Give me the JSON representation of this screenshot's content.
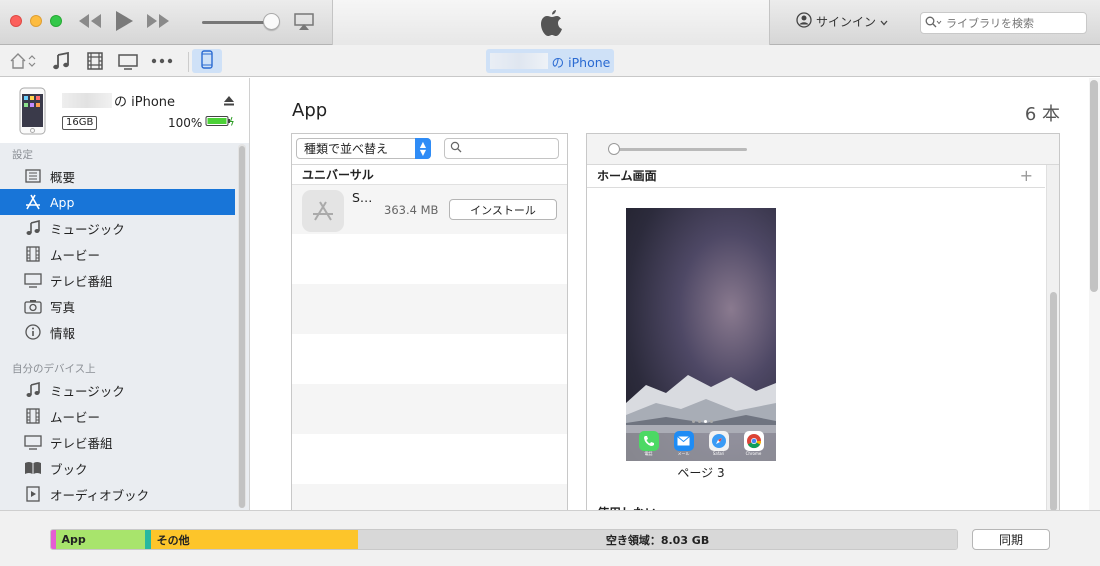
{
  "titlebar": {
    "signin_label": "サインイン",
    "search_placeholder": "ライブラリを検索"
  },
  "toolbar": {
    "device_pill_suffix": "の iPhone"
  },
  "device": {
    "name_suffix": "の iPhone",
    "capacity": "16GB",
    "battery": "100%"
  },
  "sidebar": {
    "section_settings": "設定",
    "settings_items": [
      {
        "label": "概要",
        "icon": "summary-icon"
      },
      {
        "label": "App",
        "icon": "app-store-icon"
      },
      {
        "label": "ミュージック",
        "icon": "music-note-icon"
      },
      {
        "label": "ムービー",
        "icon": "film-icon"
      },
      {
        "label": "テレビ番組",
        "icon": "tv-icon"
      },
      {
        "label": "写真",
        "icon": "camera-icon"
      },
      {
        "label": "情報",
        "icon": "info-icon"
      }
    ],
    "section_ondevice": "自分のデバイス上",
    "device_items": [
      {
        "label": "ミュージック",
        "icon": "music-note-icon"
      },
      {
        "label": "ムービー",
        "icon": "film-icon"
      },
      {
        "label": "テレビ番組",
        "icon": "tv-icon"
      },
      {
        "label": "ブック",
        "icon": "book-icon"
      },
      {
        "label": "オーディオブック",
        "icon": "audiobook-icon"
      }
    ]
  },
  "main": {
    "title": "App",
    "count": "6 本",
    "sort_label": "種類で並べ替え",
    "group_universal": "ユニバーサル",
    "app": {
      "name": "S…",
      "size": "363.4 MB",
      "install_label": "インストール"
    },
    "home_header": "ホーム画面",
    "page_label": "ページ 3",
    "unused_header": "使用しない",
    "dock_apps": [
      {
        "label": "電話",
        "icon": "phone-icon",
        "color": "#4cd964"
      },
      {
        "label": "メール",
        "icon": "mail-icon",
        "color": "#1e8cf5"
      },
      {
        "label": "Safari",
        "icon": "safari-icon",
        "color": "#3a9bf5"
      },
      {
        "label": "Chrome",
        "icon": "chrome-icon",
        "color": "#ffffff"
      }
    ]
  },
  "capacity_bar": {
    "segments": [
      {
        "label": "",
        "color": "#e55fd3",
        "fraction": 0.005
      },
      {
        "label": "App",
        "color": "#a8e46c",
        "fraction": 0.099
      },
      {
        "label": "",
        "color": "#27b8a0",
        "fraction": 0.006
      },
      {
        "label": "その他",
        "color": "#fdc52a",
        "fraction": 0.229
      },
      {
        "label": "空き領域：8.03 GB",
        "color": "#d8d8d8",
        "fraction": 0.661
      }
    ],
    "sync_label": "同期"
  },
  "colors": {
    "accent": "#1875d8",
    "selection_pill": "#cfe1f7"
  }
}
